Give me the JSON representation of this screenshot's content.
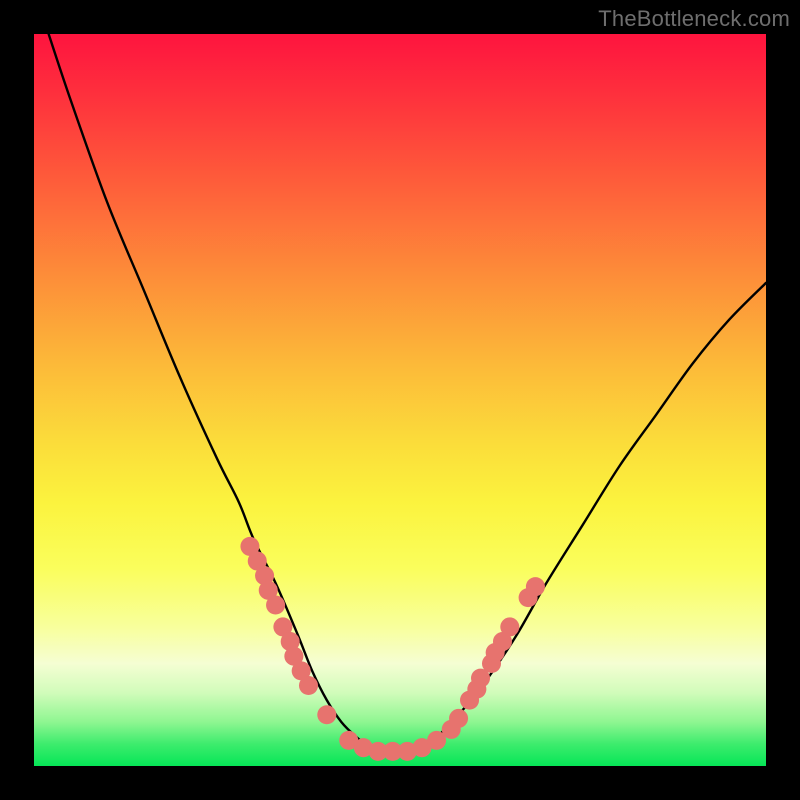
{
  "watermark": "TheBottleneck.com",
  "chart_data": {
    "type": "line",
    "title": "",
    "xlabel": "",
    "ylabel": "",
    "xlim": [
      0,
      100
    ],
    "ylim": [
      0,
      100
    ],
    "gradient_stops": [
      {
        "pos": 0,
        "color": "#fe143e"
      },
      {
        "pos": 8,
        "color": "#fe2f3d"
      },
      {
        "pos": 20,
        "color": "#fe5c3a"
      },
      {
        "pos": 33,
        "color": "#fd8d39"
      },
      {
        "pos": 45,
        "color": "#fcb939"
      },
      {
        "pos": 56,
        "color": "#fbdd3a"
      },
      {
        "pos": 64,
        "color": "#fbf33e"
      },
      {
        "pos": 73,
        "color": "#fafe5c"
      },
      {
        "pos": 81,
        "color": "#f8ff9c"
      },
      {
        "pos": 86,
        "color": "#f5fed3"
      },
      {
        "pos": 90,
        "color": "#d1fcba"
      },
      {
        "pos": 94,
        "color": "#8ef691"
      },
      {
        "pos": 97,
        "color": "#3dec6d"
      },
      {
        "pos": 100,
        "color": "#06e657"
      }
    ],
    "series": [
      {
        "name": "curve",
        "color": "#000000",
        "x": [
          2,
          5,
          10,
          15,
          20,
          25,
          28,
          30,
          33,
          36,
          38,
          40,
          42,
          44,
          46,
          48,
          50,
          52,
          55,
          58,
          62,
          66,
          70,
          75,
          80,
          85,
          90,
          95,
          100
        ],
        "y": [
          100,
          91,
          77,
          65,
          53,
          42,
          36,
          31,
          25,
          18,
          13,
          9,
          6,
          4,
          2.5,
          2,
          2,
          2.5,
          4,
          7,
          12,
          18,
          25,
          33,
          41,
          48,
          55,
          61,
          66
        ]
      }
    ],
    "scatter": {
      "name": "dots",
      "color": "#e7736e",
      "radius": 1.3,
      "points": [
        {
          "x": 29.5,
          "y": 30
        },
        {
          "x": 30.5,
          "y": 28
        },
        {
          "x": 31.5,
          "y": 26
        },
        {
          "x": 32,
          "y": 24
        },
        {
          "x": 33,
          "y": 22
        },
        {
          "x": 34,
          "y": 19
        },
        {
          "x": 35,
          "y": 17
        },
        {
          "x": 35.5,
          "y": 15
        },
        {
          "x": 36.5,
          "y": 13
        },
        {
          "x": 37.5,
          "y": 11
        },
        {
          "x": 40,
          "y": 7
        },
        {
          "x": 43,
          "y": 3.5
        },
        {
          "x": 45,
          "y": 2.5
        },
        {
          "x": 47,
          "y": 2
        },
        {
          "x": 49,
          "y": 2
        },
        {
          "x": 51,
          "y": 2
        },
        {
          "x": 53,
          "y": 2.5
        },
        {
          "x": 55,
          "y": 3.5
        },
        {
          "x": 57,
          "y": 5
        },
        {
          "x": 58,
          "y": 6.5
        },
        {
          "x": 59.5,
          "y": 9
        },
        {
          "x": 60.5,
          "y": 10.5
        },
        {
          "x": 61,
          "y": 12
        },
        {
          "x": 62.5,
          "y": 14
        },
        {
          "x": 63,
          "y": 15.5
        },
        {
          "x": 64,
          "y": 17
        },
        {
          "x": 65,
          "y": 19
        },
        {
          "x": 67.5,
          "y": 23
        },
        {
          "x": 68.5,
          "y": 24.5
        }
      ]
    }
  }
}
